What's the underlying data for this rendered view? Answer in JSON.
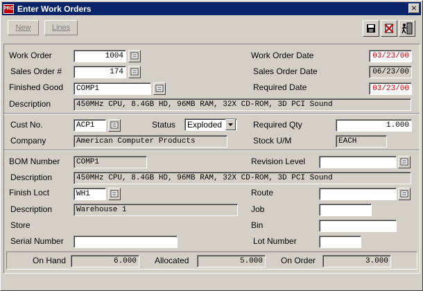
{
  "window": {
    "app_icon_text": "PRO",
    "title": "Enter Work Orders",
    "close_glyph": "×"
  },
  "toolbar": {
    "new_label": "New",
    "lines_label": "Lines",
    "icons": [
      "save-icon",
      "delete-icon",
      "exit-icon"
    ]
  },
  "header": {
    "work_order_label": "Work Order",
    "work_order_value": "1004",
    "sales_order_label": "Sales Order #",
    "sales_order_value": "174",
    "finished_good_label": "Finished Good",
    "finished_good_value": "COMP1",
    "description_label": "Description",
    "description_value": "450MHz CPU, 8.4GB HD, 96MB RAM, 32X CD-ROM, 3D PCI Sound",
    "work_order_date_label": "Work Order Date",
    "work_order_date_value": "03/23/00",
    "sales_order_date_label": "Sales Order Date",
    "sales_order_date_value": "06/23/00",
    "required_date_label": "Required Date",
    "required_date_value": "03/23/00"
  },
  "customer": {
    "cust_no_label": "Cust No.",
    "cust_no_value": "ACP1",
    "status_label": "Status",
    "status_value": "Exploded",
    "company_label": "Company",
    "company_value": "American Computer Products",
    "required_qty_label": "Required Qty",
    "required_qty_value": "1.000",
    "stock_um_label": "Stock U/M",
    "stock_um_value": "EACH"
  },
  "bom": {
    "bom_number_label": "BOM Number",
    "bom_number_value": "COMP1",
    "revision_level_label": "Revision Level",
    "revision_level_value": "",
    "description_label": "Description",
    "description_value": "450MHz CPU, 8.4GB HD, 96MB RAM, 32X CD-ROM, 3D PCI Sound",
    "finish_loct_label": "Finish Loct",
    "finish_loct_value": "WH1",
    "route_label": "Route",
    "route_value": "",
    "loct_description_label": "Description",
    "loct_description_value": "Warehouse 1",
    "job_label": "Job",
    "job_value": "",
    "store_label": "Store",
    "bin_label": "Bin",
    "bin_value": "",
    "serial_number_label": "Serial Number",
    "serial_number_value": "",
    "lot_number_label": "Lot Number",
    "lot_number_value": ""
  },
  "totals": {
    "on_hand_label": "On Hand",
    "on_hand_value": "6.000",
    "allocated_label": "Allocated",
    "allocated_value": "5.000",
    "on_order_label": "On Order",
    "on_order_value": "3.000"
  },
  "colors": {
    "titlebar": "#0a246a",
    "date_highlight": "#c00000"
  }
}
